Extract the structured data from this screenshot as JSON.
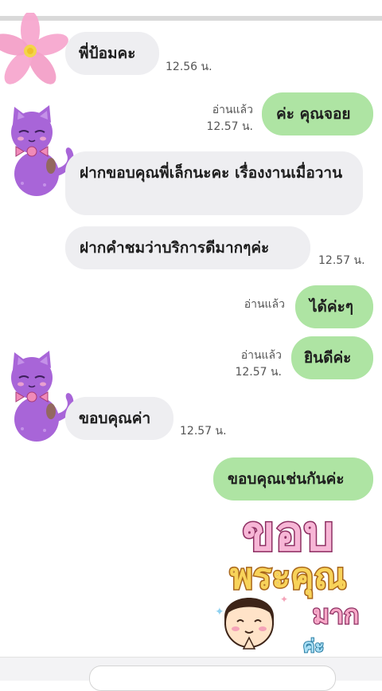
{
  "messages": [
    {
      "side": "in",
      "text": "พี่ป้อมคะ",
      "time": "12.56 น."
    },
    {
      "side": "out",
      "text": "ค่ะ คุณจอย",
      "read": "อ่านแล้ว",
      "time": "12.57 น."
    },
    {
      "side": "in",
      "text": "ฝากขอบคุณพี่เล็กนะคะ เรื่องงานเมื่อวาน"
    },
    {
      "side": "in",
      "text": "ฝากคำชมว่าบริการดีมากๆค่ะ",
      "time": "12.57 น."
    },
    {
      "side": "out",
      "text": "ได้ค่ะๆ",
      "read": "อ่านแล้ว"
    },
    {
      "side": "out",
      "text": "ยินดีค่ะ",
      "read": "อ่านแล้ว",
      "time": "12.57 น."
    },
    {
      "side": "in",
      "text": "ขอบคุณค่า",
      "time": "12.57 น."
    },
    {
      "side": "out",
      "text": "ขอบคุณเช่นกันค่ะ"
    }
  ],
  "sticker": {
    "line1": "ขอบ",
    "line2": "พระคุณ",
    "line3": "มาก",
    "line4": "ค่ะ"
  },
  "colors": {
    "incoming_bubble": "#eeeef1",
    "outgoing_bubble": "#aee4a3",
    "avatar_cat": "#a865d8",
    "bow": "#f08ab8"
  },
  "icons": [
    "flower-avatar-icon",
    "cat-avatar-icon",
    "thank-you-sticker"
  ]
}
